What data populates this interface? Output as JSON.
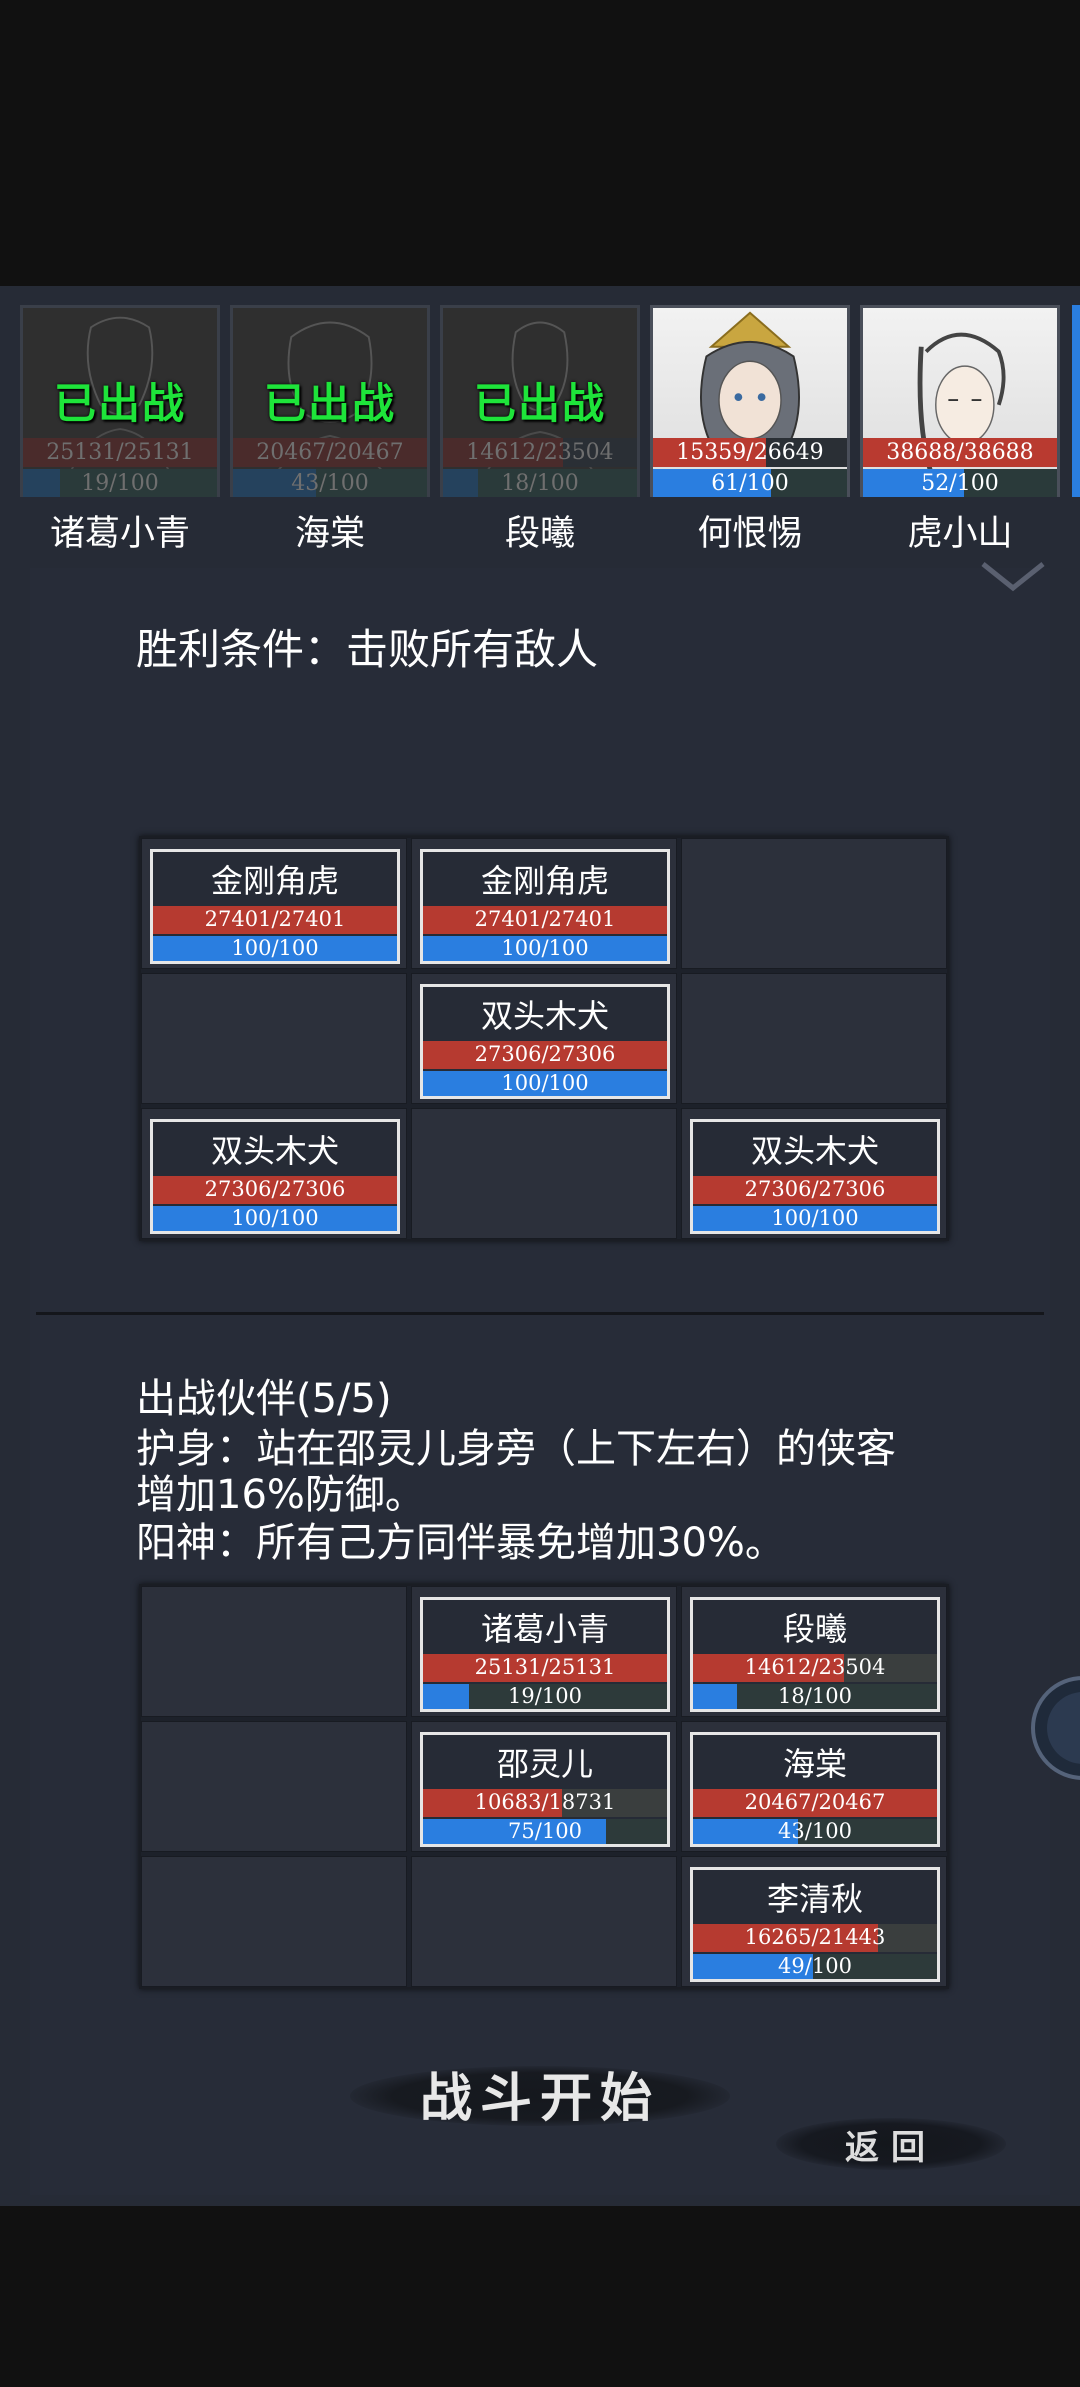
{
  "roster": [
    {
      "name": "诸葛小青",
      "status": "已出战",
      "hp": "25131/25131",
      "hp_ratio": 1.0,
      "mp": "19/100",
      "mp_ratio": 0.19,
      "deployed": true
    },
    {
      "name": "海棠",
      "status": "已出战",
      "hp": "20467/20467",
      "hp_ratio": 1.0,
      "mp": "43/100",
      "mp_ratio": 0.43,
      "deployed": true
    },
    {
      "name": "段曦",
      "status": "已出战",
      "hp": "14612/23504",
      "hp_ratio": 0.62,
      "mp": "18/100",
      "mp_ratio": 0.18,
      "deployed": true
    },
    {
      "name": "何恨惕",
      "status": "",
      "hp": "15359/26649",
      "hp_ratio": 0.58,
      "mp": "61/100",
      "mp_ratio": 0.61,
      "deployed": false
    },
    {
      "name": "虎小山",
      "status": "",
      "hp": "38688/38688",
      "hp_ratio": 1.0,
      "mp": "52/100",
      "mp_ratio": 0.52,
      "deployed": false
    }
  ],
  "victory_condition": "胜利条件：击败所有敌人",
  "enemies": [
    {
      "name": "金刚角虎",
      "hp": "27401/27401",
      "hp_ratio": 1.0,
      "mp": "100/100",
      "mp_ratio": 1.0
    },
    {
      "name": "金刚角虎",
      "hp": "27401/27401",
      "hp_ratio": 1.0,
      "mp": "100/100",
      "mp_ratio": 1.0
    },
    {
      "name": "双头木犬",
      "hp": "27306/27306",
      "hp_ratio": 1.0,
      "mp": "100/100",
      "mp_ratio": 1.0
    },
    {
      "name": "双头木犬",
      "hp": "27306/27306",
      "hp_ratio": 1.0,
      "mp": "100/100",
      "mp_ratio": 1.0
    },
    {
      "name": "双头木犬",
      "hp": "27306/27306",
      "hp_ratio": 1.0,
      "mp": "100/100",
      "mp_ratio": 1.0
    }
  ],
  "team_title": "出战伙伴(5/5)",
  "bonuses": [
    "护身：站在邵灵儿身旁（上下左右）的侠客",
    "增加16%防御。",
    "阳神：所有己方同伴暴免增加30%。"
  ],
  "allies": [
    {
      "name": "诸葛小青",
      "hp": "25131/25131",
      "hp_ratio": 1.0,
      "mp": "19/100",
      "mp_ratio": 0.19
    },
    {
      "name": "段曦",
      "hp": "14612/23504",
      "hp_ratio": 0.62,
      "mp": "18/100",
      "mp_ratio": 0.18
    },
    {
      "name": "邵灵儿",
      "hp": "10683/18731",
      "hp_ratio": 0.57,
      "mp": "75/100",
      "mp_ratio": 0.75
    },
    {
      "name": "海棠",
      "hp": "20467/20467",
      "hp_ratio": 1.0,
      "mp": "43/100",
      "mp_ratio": 0.43
    },
    {
      "name": "李清秋",
      "hp": "16265/21443",
      "hp_ratio": 0.76,
      "mp": "49/100",
      "mp_ratio": 0.49
    }
  ],
  "start_button": "战斗开始",
  "back_button": "返回",
  "colors": {
    "hp": "#b63a30",
    "mp": "#2a7ee0",
    "deployed": "#1ee43a",
    "panel": "#262b36"
  },
  "icons": {
    "collapse": "chevron-down-icon",
    "side": "scroll-orb-icon"
  }
}
